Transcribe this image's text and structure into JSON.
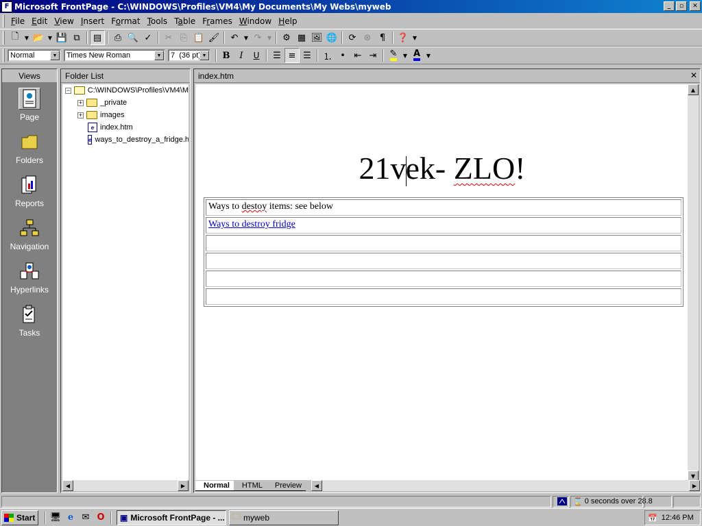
{
  "window": {
    "title": "Microsoft FrontPage - C:\\WINDOWS\\Profiles\\VM4\\My Documents\\My Webs\\myweb",
    "controls": {
      "minimize": "_",
      "maximize": "▫",
      "close": "✕"
    }
  },
  "menu": [
    {
      "pre": "",
      "key": "F",
      "post": "ile"
    },
    {
      "pre": "",
      "key": "E",
      "post": "dit"
    },
    {
      "pre": "",
      "key": "V",
      "post": "iew"
    },
    {
      "pre": "",
      "key": "I",
      "post": "nsert"
    },
    {
      "pre": "F",
      "key": "o",
      "post": "rmat"
    },
    {
      "pre": "",
      "key": "T",
      "post": "ools"
    },
    {
      "pre": "T",
      "key": "a",
      "post": "ble"
    },
    {
      "pre": "F",
      "key": "r",
      "post": "ames"
    },
    {
      "pre": "",
      "key": "W",
      "post": "indow"
    },
    {
      "pre": "",
      "key": "H",
      "post": "elp"
    }
  ],
  "format_toolbar": {
    "style": "Normal",
    "font": "Times New Roman",
    "size": "7  (36 pt)",
    "bold": "B",
    "italic": "I",
    "underline": "U"
  },
  "views": {
    "header": "Views",
    "items": [
      {
        "label": "Page",
        "icon": "page-view-icon"
      },
      {
        "label": "Folders",
        "icon": "folders-view-icon"
      },
      {
        "label": "Reports",
        "icon": "reports-view-icon"
      },
      {
        "label": "Navigation",
        "icon": "navigation-view-icon"
      },
      {
        "label": "Hyperlinks",
        "icon": "hyperlinks-view-icon"
      },
      {
        "label": "Tasks",
        "icon": "tasks-view-icon"
      }
    ]
  },
  "folder_list": {
    "header": "Folder List",
    "root": "C:\\WINDOWS\\Profiles\\VM4\\M",
    "items": [
      {
        "label": "_private",
        "type": "folder"
      },
      {
        "label": "images",
        "type": "folder"
      },
      {
        "label": "index.htm",
        "type": "page"
      },
      {
        "label": "ways_to_destroy_a_fridge.h",
        "type": "page"
      }
    ]
  },
  "editor": {
    "tab_title": "index.htm",
    "heading_parts": [
      "21v",
      "ek- ",
      "ZLO",
      "!"
    ],
    "table_rows": [
      {
        "pre": "Ways to ",
        "squiggle": "destoy",
        "post": " items: see below",
        "link": false
      },
      {
        "text": "Ways to destroy fridge",
        "link": true
      },
      {
        "text": ""
      },
      {
        "text": ""
      },
      {
        "text": ""
      },
      {
        "text": ""
      }
    ],
    "mode_tabs": [
      "Normal",
      "HTML",
      "Preview"
    ],
    "active_mode": "Normal"
  },
  "status": {
    "download_time": "0 seconds over 28.8"
  },
  "taskbar": {
    "start": "Start",
    "tasks": [
      {
        "label": "Microsoft FrontPage - ...",
        "active": true
      },
      {
        "label": "myweb",
        "active": false
      }
    ],
    "clock": "12:46 PM"
  }
}
